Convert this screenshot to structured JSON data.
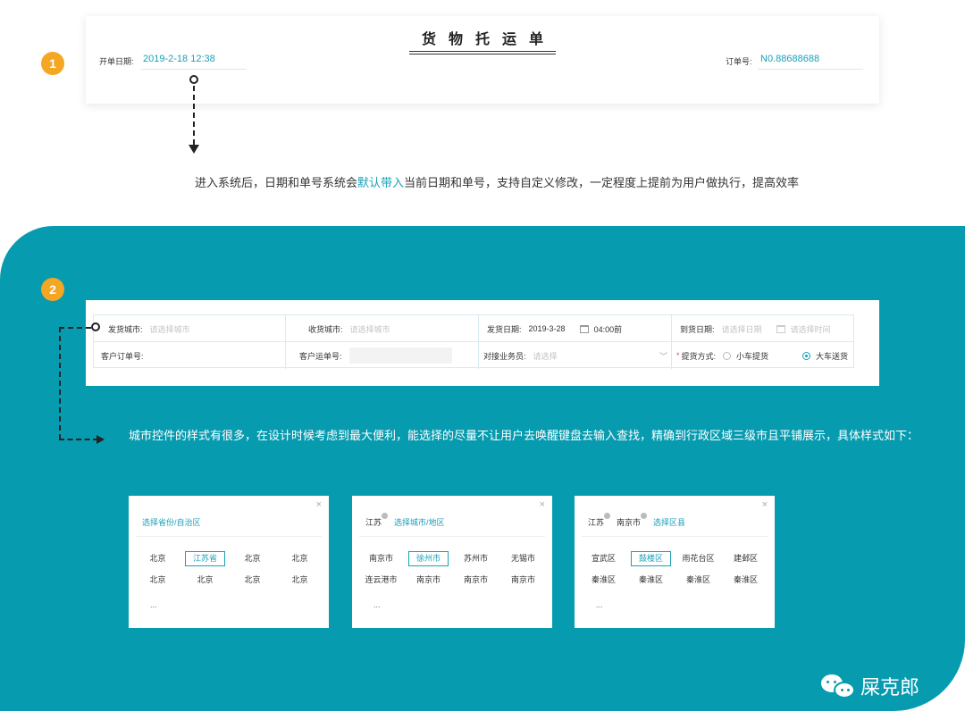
{
  "step1": {
    "badge": "1"
  },
  "step2": {
    "badge": "2"
  },
  "waybill": {
    "title": "货物托运单",
    "date_label": "开单日期:",
    "date_value": "2019-2-18 12:38",
    "order_label": "订单号:",
    "order_value": "N0.88688688"
  },
  "note1": {
    "before": "进入系统后，日期和单号系统会",
    "highlight": "默认带入",
    "after": "当前日期和单号，支持自定义修改，一定程度上提前为用户做执行，提高效率"
  },
  "form": {
    "ship_city_label": "发货城市:",
    "ship_city_placeholder": "请选择城市",
    "recv_city_label": "收货城市:",
    "recv_city_placeholder": "请选择城市",
    "ship_date_label": "发货日期:",
    "ship_date_value": "2019-3-28",
    "ship_time_value": "04:00前",
    "arrive_date_label": "到货日期:",
    "arrive_date_placeholder": "请选择日期",
    "arrive_time_placeholder": "请选择时间",
    "customer_order_label": "客户订单号:",
    "customer_waybill_label": "客户运单号:",
    "salesman_label": "对接业务员:",
    "salesman_placeholder": "请选择",
    "pickup_label": "提货方式:",
    "pickup_required": "*",
    "pickup_option_small": "小车提货",
    "pickup_option_big": "大车送货",
    "pickup_selected": "大车送货"
  },
  "note2": "城市控件的样式有很多，在设计时候考虑到最大便利，能选择的尽量不让用户去唤醒键盘去输入查找，精确到行政区域三级市且平铺展示，具体样式如下：",
  "pickers": [
    {
      "crumbs": [],
      "active_tab": "选择省份/自治区",
      "options": [
        "北京",
        "江苏省",
        "北京",
        "北京",
        "北京",
        "北京",
        "北京",
        "北京"
      ],
      "selected_index": 1,
      "more": "..."
    },
    {
      "crumbs": [
        "江苏"
      ],
      "active_tab": "选择城市/地区",
      "options": [
        "南京市",
        "徐州市",
        "苏州市",
        "无锡市",
        "连云港市",
        "南京市",
        "南京市",
        "南京市"
      ],
      "selected_index": 1,
      "more": "..."
    },
    {
      "crumbs": [
        "江苏",
        "南京市"
      ],
      "active_tab": "选择区县",
      "options": [
        "宣武区",
        "鼓楼区",
        "雨花台区",
        "建邺区",
        "秦淮区",
        "秦淮区",
        "秦淮区",
        "秦淮区"
      ],
      "selected_index": 1,
      "more": "..."
    }
  ],
  "close_glyph": "×",
  "brand": {
    "name": "屎克郎",
    "icon": "wechat-icon"
  },
  "colors": {
    "accent": "#1aa1b8",
    "teal_bg": "#079bb0",
    "badge": "#f5a623"
  }
}
